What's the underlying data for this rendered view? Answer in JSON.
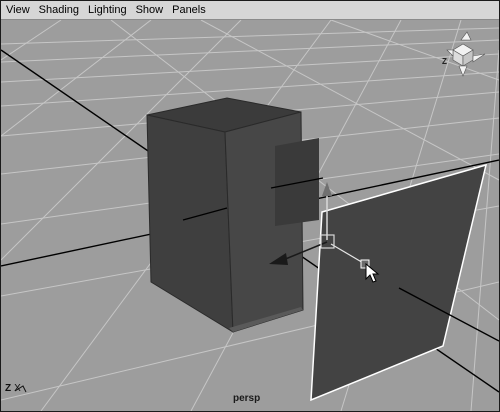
{
  "menubar": {
    "items": [
      "View",
      "Shading",
      "Lighting",
      "Show",
      "Panels"
    ]
  },
  "viewport": {
    "camera_label": "persp",
    "view_cube": {
      "z_label": "Z"
    },
    "axis_indicator": {
      "z_label": "Z",
      "x_label": "X"
    }
  },
  "colors": {
    "background": "#9d9d9d",
    "grid_line": "#c4c4c4",
    "axis_line": "#000000",
    "mesh_dark": "#3e3e3e",
    "mesh_mid": "#4a4a4a",
    "selection_outline": "#ffffff",
    "menubar_bg": "#d6d6d6"
  },
  "icons": {
    "view_cube": "view-cube-icon",
    "cursor": "mouse-pointer-icon",
    "move_manipulator": "move-manipulator-icon"
  }
}
